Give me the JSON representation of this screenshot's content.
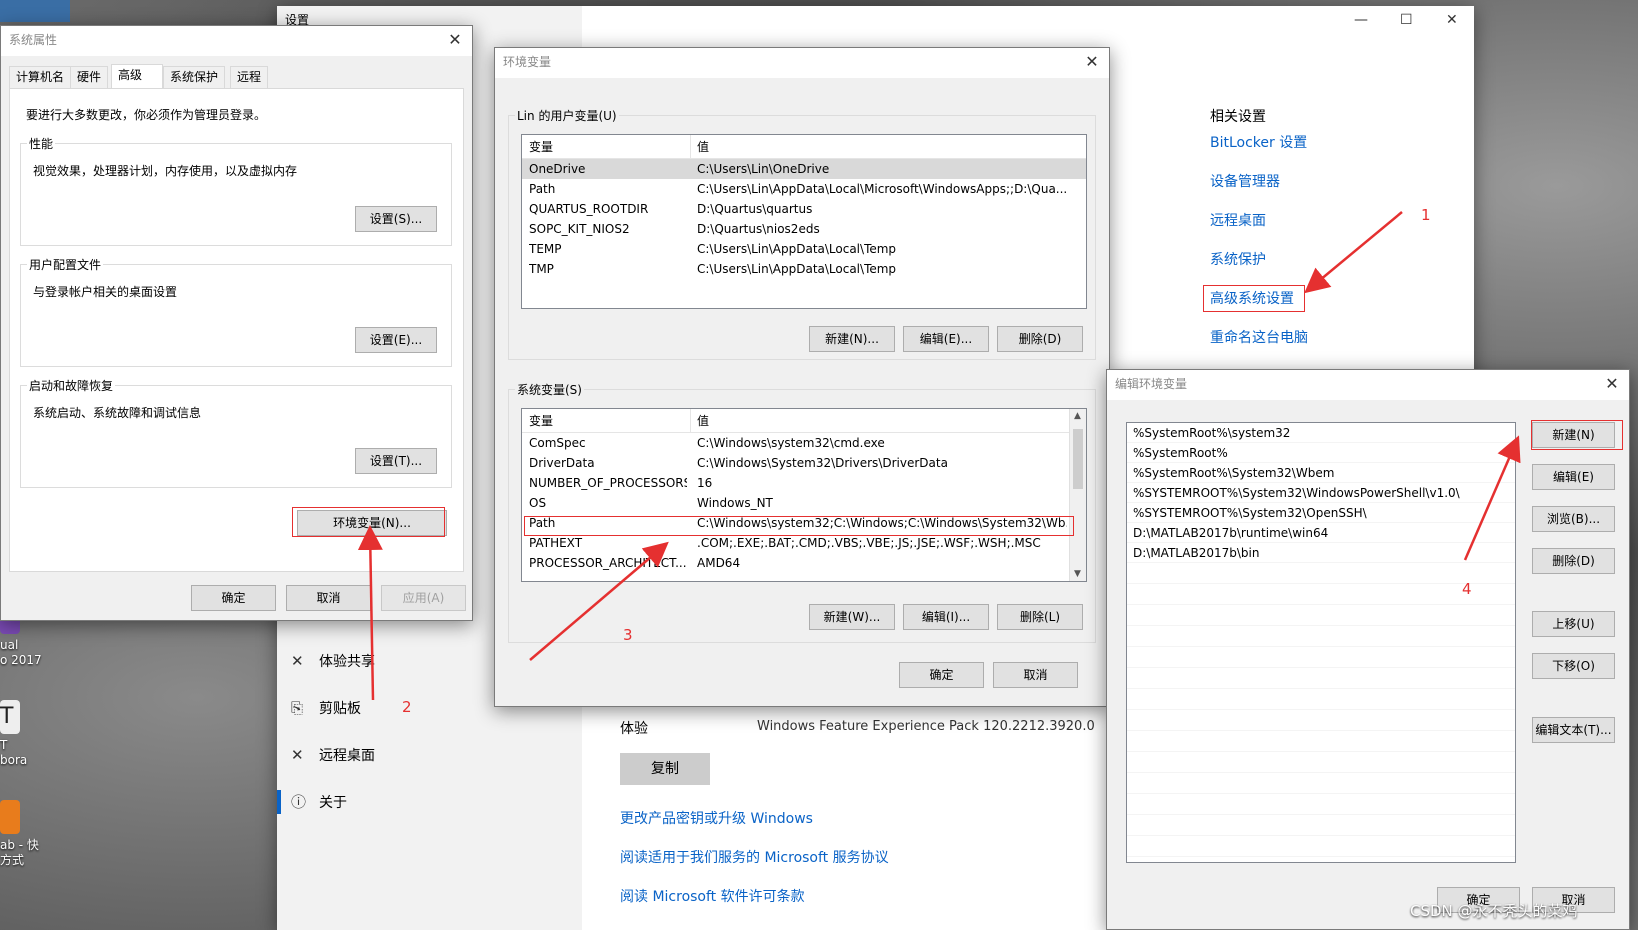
{
  "desktop": {
    "icons": [
      {
        "label": "ual\no 2017",
        "color": "#7b4bb5"
      },
      {
        "label": "T\nbora",
        "color": "#eeeeee"
      },
      {
        "label": "ab - 快\n方式",
        "color": "#e87c1c"
      }
    ],
    "watermark": "CSDN @永不秃头的菜鸡"
  },
  "settings": {
    "title": "设置",
    "sidebar": [
      {
        "icon": "✕",
        "label": "体验共享"
      },
      {
        "icon": "⎘",
        "label": "剪贴板"
      },
      {
        "icon": "✕",
        "label": "远程桌面"
      },
      {
        "icon": "ⓘ",
        "label": "关于"
      }
    ],
    "related_title": "相关设置",
    "related_links": [
      "BitLocker 设置",
      "设备管理器",
      "远程桌面",
      "系统保护",
      "高级系统设置",
      "重命名这台电脑"
    ],
    "experience_label": "体验",
    "experience_value": "Windows Feature Experience Pack 120.2212.3920.0",
    "copy_button": "复制",
    "bottom_links": [
      "更改产品密钥或升级 Windows",
      "阅读适用于我们服务的 Microsoft 服务协议",
      "阅读 Microsoft 软件许可条款"
    ]
  },
  "sysprops": {
    "title": "系统属性",
    "tabs": [
      "计算机名",
      "硬件",
      "高级",
      "系统保护",
      "远程"
    ],
    "admin_note": "要进行大多数更改，你必须作为管理员登录。",
    "groups": [
      {
        "title": "性能",
        "desc": "视觉效果，处理器计划，内存使用，以及虚拟内存",
        "button": "设置(S)..."
      },
      {
        "title": "用户配置文件",
        "desc": "与登录帐户相关的桌面设置",
        "button": "设置(E)..."
      },
      {
        "title": "启动和故障恢复",
        "desc": "系统启动、系统故障和调试信息",
        "button": "设置(T)..."
      }
    ],
    "env_button": "环境变量(N)...",
    "ok": "确定",
    "cancel": "取消",
    "apply": "应用(A)"
  },
  "envvars": {
    "title": "环境变量",
    "user_group": "Lin 的用户变量(U)",
    "col_var": "变量",
    "col_val": "值",
    "user_vars": [
      {
        "name": "OneDrive",
        "value": "C:\\Users\\Lin\\OneDrive"
      },
      {
        "name": "Path",
        "value": "C:\\Users\\Lin\\AppData\\Local\\Microsoft\\WindowsApps;;D:\\Qua..."
      },
      {
        "name": "QUARTUS_ROOTDIR",
        "value": "D:\\Quartus\\quartus"
      },
      {
        "name": "SOPC_KIT_NIOS2",
        "value": "D:\\Quartus\\nios2eds"
      },
      {
        "name": "TEMP",
        "value": "C:\\Users\\Lin\\AppData\\Local\\Temp"
      },
      {
        "name": "TMP",
        "value": "C:\\Users\\Lin\\AppData\\Local\\Temp"
      }
    ],
    "user_buttons": [
      "新建(N)...",
      "编辑(E)...",
      "删除(D)"
    ],
    "sys_group": "系统变量(S)",
    "sys_vars": [
      {
        "name": "ComSpec",
        "value": "C:\\Windows\\system32\\cmd.exe"
      },
      {
        "name": "DriverData",
        "value": "C:\\Windows\\System32\\Drivers\\DriverData"
      },
      {
        "name": "NUMBER_OF_PROCESSORS",
        "value": "16"
      },
      {
        "name": "OS",
        "value": "Windows_NT"
      },
      {
        "name": "Path",
        "value": "C:\\Windows\\system32;C:\\Windows;C:\\Windows\\System32\\Wb..."
      },
      {
        "name": "PATHEXT",
        "value": ".COM;.EXE;.BAT;.CMD;.VBS;.VBE;.JS;.JSE;.WSF;.WSH;.MSC"
      },
      {
        "name": "PROCESSOR_ARCHITECT...",
        "value": "AMD64"
      }
    ],
    "sys_buttons": [
      "新建(W)...",
      "编辑(I)...",
      "删除(L)"
    ],
    "ok": "确定",
    "cancel": "取消"
  },
  "editenv": {
    "title": "编辑环境变量",
    "paths": [
      "%SystemRoot%\\system32",
      "%SystemRoot%",
      "%SystemRoot%\\System32\\Wbem",
      "%SYSTEMROOT%\\System32\\WindowsPowerShell\\v1.0\\",
      "%SYSTEMROOT%\\System32\\OpenSSH\\",
      "D:\\MATLAB2017b\\runtime\\win64",
      "D:\\MATLAB2017b\\bin"
    ],
    "buttons": [
      "新建(N)",
      "编辑(E)",
      "浏览(B)...",
      "删除(D)",
      "上移(U)",
      "下移(O)",
      "编辑文本(T)..."
    ],
    "ok": "确定",
    "cancel": "取消"
  },
  "annotations": [
    "1",
    "2",
    "3",
    "4"
  ],
  "colors": {
    "accent_link": "#0a63c7",
    "annotation_red": "#e53030"
  }
}
